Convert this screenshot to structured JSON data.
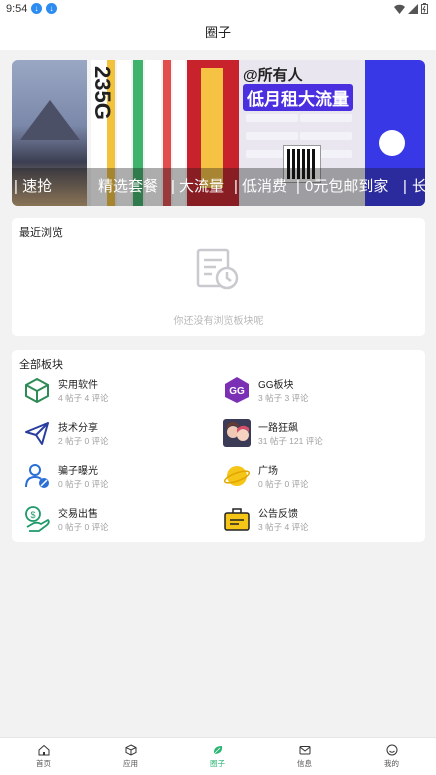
{
  "status_bar": {
    "time": "9:54"
  },
  "header": {
    "title": "圈子"
  },
  "banner": {
    "ticker_segments": [
      "| 速抢",
      "精选套餐",
      "|",
      "大流量",
      "|",
      "低消费",
      "|",
      "0元包邮到家",
      "|",
      "长"
    ],
    "poster_headline_1": "@所有人",
    "poster_headline_2": "低月租大流量",
    "poster_side_digits": "235G"
  },
  "recent": {
    "title": "最近浏览",
    "empty_text": "你还没有浏览板块呢"
  },
  "all_boards": {
    "title": "全部板块",
    "items": [
      {
        "name": "实用软件",
        "stats": "4 帖子 4 评论",
        "icon": "cube-box-icon"
      },
      {
        "name": "GG板块",
        "stats": "3 帖子 3 评论",
        "icon": "gg-logo-icon"
      },
      {
        "name": "技术分享",
        "stats": "2 帖子 0 评论",
        "icon": "paper-plane-icon"
      },
      {
        "name": "一路狂飙",
        "stats": "31 帖子 121 评论",
        "icon": "anime-avatar-icon"
      },
      {
        "name": "骗子曝光",
        "stats": "0 帖子 0 评论",
        "icon": "user-block-icon"
      },
      {
        "name": "广场",
        "stats": "0 帖子 0 评论",
        "icon": "planet-icon"
      },
      {
        "name": "交易出售",
        "stats": "0 帖子 0 评论",
        "icon": "money-hand-icon"
      },
      {
        "name": "公告反馈",
        "stats": "3 帖子 4 评论",
        "icon": "briefcase-icon"
      }
    ]
  },
  "tabbar": {
    "items": [
      {
        "label": "首页",
        "icon": "home-icon"
      },
      {
        "label": "应用",
        "icon": "apps-cube-icon"
      },
      {
        "label": "圈子",
        "icon": "leaf-icon",
        "active": true
      },
      {
        "label": "信息",
        "icon": "mail-icon"
      },
      {
        "label": "我的",
        "icon": "smile-icon"
      }
    ]
  },
  "colors": {
    "accent": "#2bb673",
    "banner_purple": "#4a2fe0",
    "planet_yellow": "#f5c518"
  }
}
